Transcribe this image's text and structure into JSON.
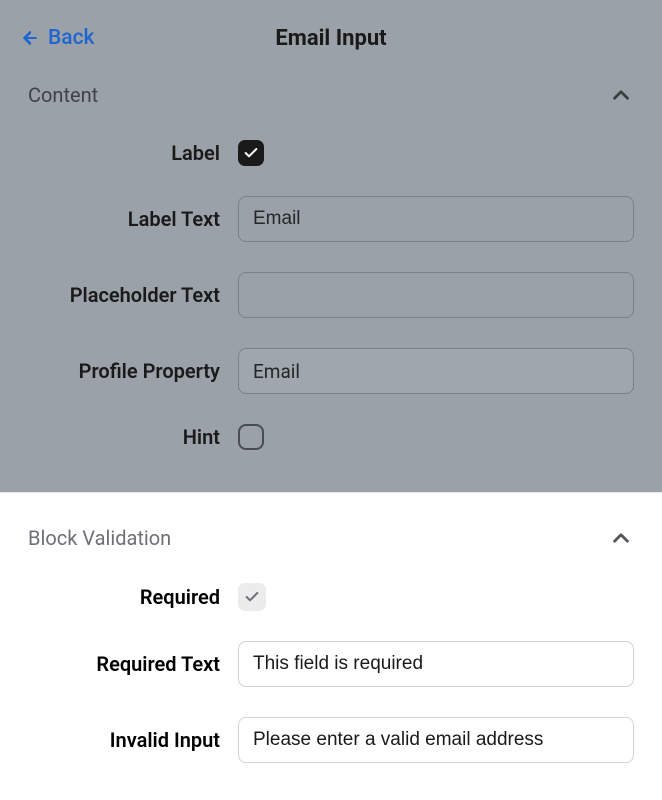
{
  "header": {
    "back_label": "Back",
    "title": "Email Input"
  },
  "content_section": {
    "title": "Content",
    "fields": {
      "label": {
        "label": "Label",
        "checked": true
      },
      "label_text": {
        "label": "Label Text",
        "value": "Email"
      },
      "placeholder_text": {
        "label": "Placeholder Text",
        "value": ""
      },
      "profile_property": {
        "label": "Profile Property",
        "value": "Email"
      },
      "hint": {
        "label": "Hint",
        "checked": false
      }
    }
  },
  "validation_section": {
    "title": "Block Validation",
    "fields": {
      "required": {
        "label": "Required",
        "checked": true
      },
      "required_text": {
        "label": "Required Text",
        "value": "This field is required"
      },
      "invalid_input": {
        "label": "Invalid Input",
        "value": "Please enter a valid email address"
      }
    }
  }
}
